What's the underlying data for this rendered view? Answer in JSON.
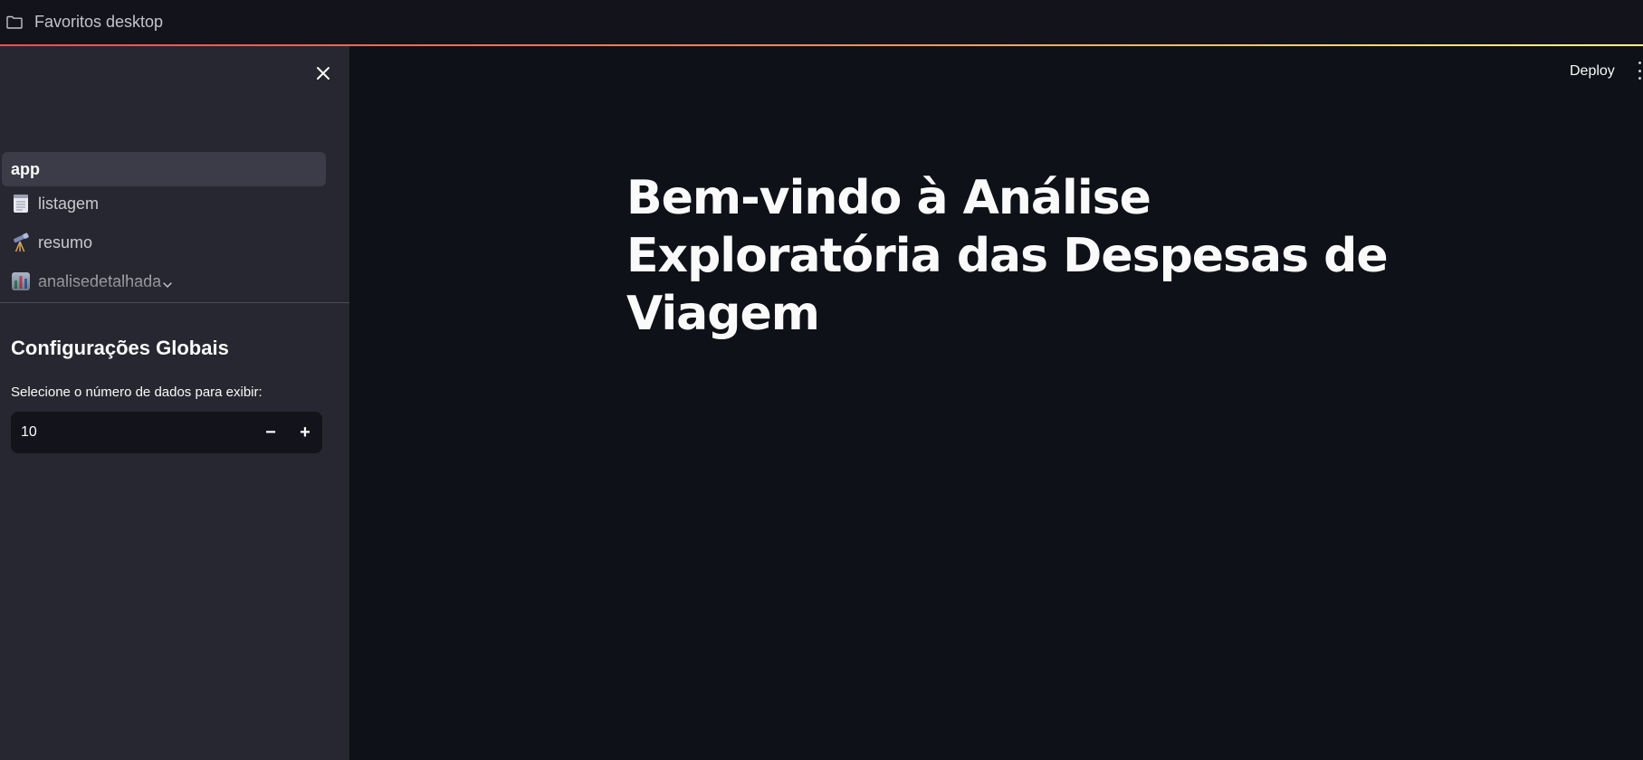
{
  "bookmarks_bar": {
    "folder_label": "Favoritos desktop",
    "folder_icon": "folder-icon"
  },
  "sidebar": {
    "close_icon": "close-icon",
    "nav_items": [
      {
        "label": "app",
        "icon": "",
        "active": true
      },
      {
        "label": "listagem",
        "icon": "notepad-icon",
        "active": false
      },
      {
        "label": "resumo",
        "icon": "telescope-icon",
        "active": false
      },
      {
        "label": "analisedetalhada",
        "icon": "bar-chart-icon",
        "active": false
      }
    ],
    "expand_icon": "chevron-down-icon",
    "settings_header": "Configurações Globais",
    "number_input": {
      "label": "Selecione o número de dados para exibir:",
      "value": "10",
      "decrement": "−",
      "increment": "+"
    }
  },
  "main": {
    "deploy_label": "Deploy",
    "menu_icon": "more-vertical-icon",
    "title": "Bem-vindo à Análise Exploratória das Despesas de Viagem"
  },
  "colors": {
    "app_background": "#0e1117",
    "sidebar_background": "#262730",
    "text_primary": "#fafafa",
    "accent": "#ff4b4b"
  }
}
